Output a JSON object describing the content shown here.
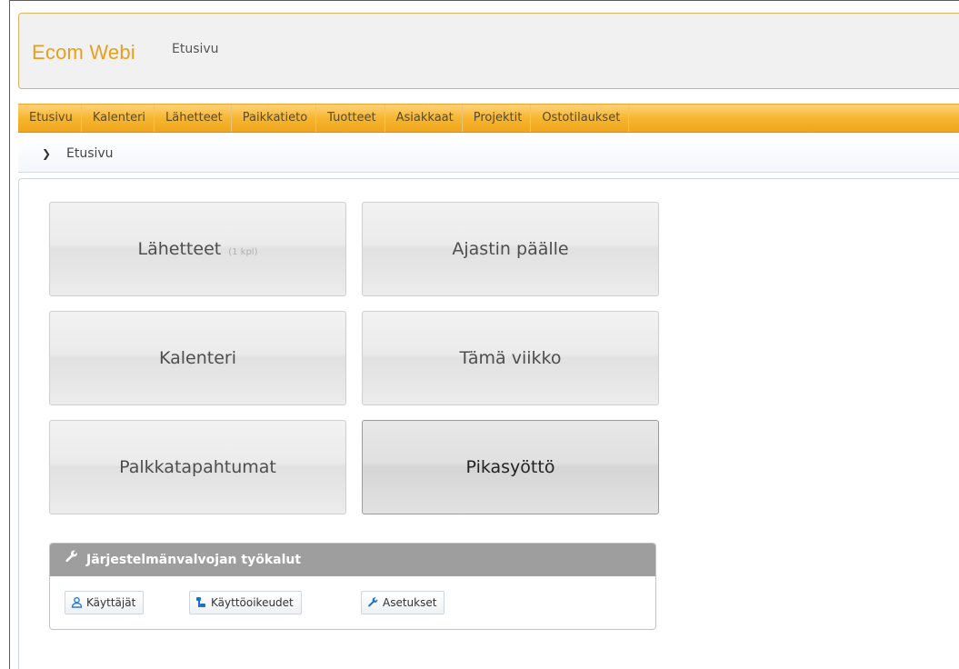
{
  "header": {
    "logo": "Ecom Webi",
    "title": "Etusivu"
  },
  "nav": {
    "items": [
      "Etusivu",
      "Kalenteri",
      "Lähetteet",
      "Paikkatieto",
      "Tuotteet",
      "Asiakkaat",
      "Projektit",
      "Ostotilaukset"
    ]
  },
  "breadcrumb": {
    "text": "Etusivu"
  },
  "tiles": {
    "lahetteet": {
      "label": "Lähetteet",
      "count": "(1 kpl)"
    },
    "ajastin": {
      "label": "Ajastin päälle"
    },
    "kalenteri": {
      "label": "Kalenteri"
    },
    "viikko": {
      "label": "Tämä viikko"
    },
    "palkka": {
      "label": "Palkkatapahtumat"
    },
    "pika": {
      "label": "Pikasyöttö"
    }
  },
  "admin": {
    "title": "Järjestelmänvalvojan työkalut",
    "buttons": {
      "users": "Käyttäjät",
      "rights": "Käyttöoikeudet",
      "settings": "Asetukset"
    }
  },
  "colors": {
    "accent": "#e8a01c",
    "nav_bg": "#f6b630",
    "admin_header": "#9e9e9e"
  }
}
